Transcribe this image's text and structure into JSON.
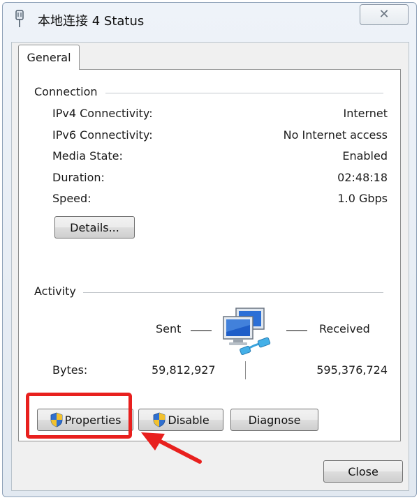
{
  "window": {
    "title": "本地连接 4 Status",
    "close_glyph": "✕"
  },
  "tabs": [
    {
      "label": "General"
    }
  ],
  "connection": {
    "title": "Connection",
    "rows": [
      {
        "label": "IPv4 Connectivity:",
        "value": "Internet"
      },
      {
        "label": "IPv6 Connectivity:",
        "value": "No Internet access"
      },
      {
        "label": "Media State:",
        "value": "Enabled"
      },
      {
        "label": "Duration:",
        "value": "02:48:18"
      },
      {
        "label": "Speed:",
        "value": "1.0 Gbps"
      }
    ],
    "details_label": "Details..."
  },
  "activity": {
    "title": "Activity",
    "sent_label": "Sent",
    "received_label": "Received",
    "bytes_label": "Bytes:",
    "bytes_sent": "59,812,927",
    "bytes_received": "595,376,724"
  },
  "buttons": {
    "properties": "Properties",
    "disable": "Disable",
    "diagnose": "Diagnose",
    "close": "Close"
  },
  "colors": {
    "highlight": "#e8201e",
    "shield_blue": "#2f6fd0",
    "shield_yellow": "#f2c12e"
  },
  "icons": {
    "title": "network-adapter-icon",
    "activity": "network-computers-icon",
    "button": "uac-shield-icon"
  }
}
